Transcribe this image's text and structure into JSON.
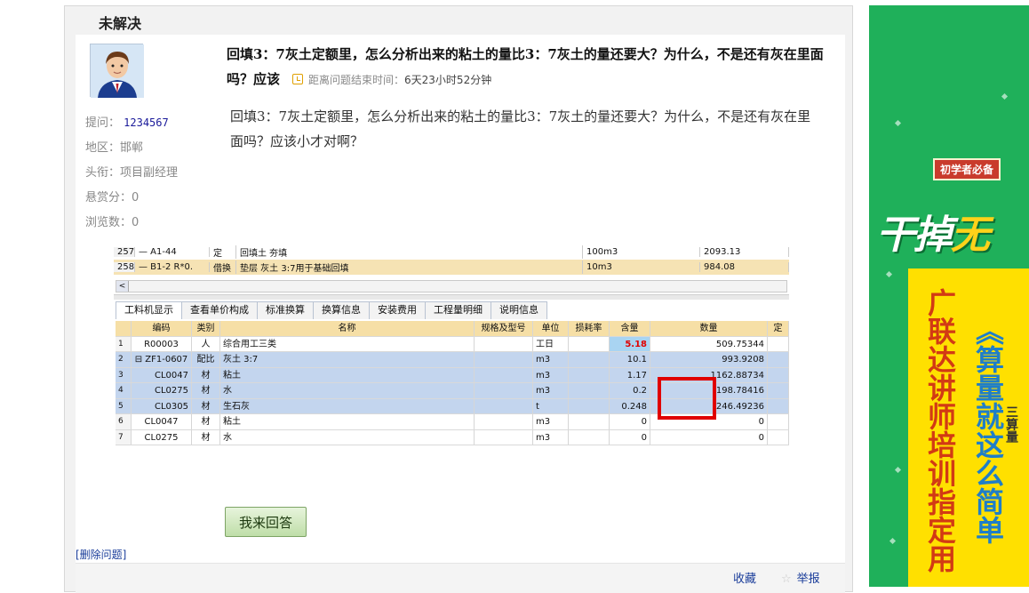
{
  "question": {
    "status": "未解决",
    "asker_label": "提问：",
    "asker": "1234567",
    "region_label": "地区：",
    "region": "邯郸",
    "rank_label": "头衔：",
    "rank": "项目副经理",
    "reward_label": "悬赏分：",
    "reward": "0",
    "views_label": "浏览数：",
    "views": "0",
    "title": "回填3：7灰土定额里，怎么分析出来的粘土的量比3：7灰土的量还要大？为什么，不是还有灰在里面吗？应该",
    "deadline_label": "距离问题结束时间：",
    "deadline_value": "6天23小时52分钟",
    "body": "回填3：7灰土定额里，怎么分析出来的粘土的量比3：7灰土的量还要大？为什么，不是还有灰在里面吗？应该小才对啊？",
    "answer_button": "我来回答",
    "delete_link": "[删除问题]",
    "favorite_link": "收藏",
    "report_link": "举报"
  },
  "screenshot": {
    "top_rows": [
      {
        "no": "257",
        "code": "— A1-44",
        "type": "定",
        "name": "回填土 夯填",
        "unit": "100m3",
        "qty": "2093.13"
      },
      {
        "no": "258",
        "code": "— B1-2 R*0.",
        "type": "借换",
        "name": "垫层 灰土 3:7用于基础回填",
        "unit": "10m3",
        "qty": "984.08"
      }
    ],
    "scroll_left": "<",
    "tabs": [
      "工料机显示",
      "查看单价构成",
      "标准换算",
      "换算信息",
      "安装费用",
      "工程量明细",
      "说明信息"
    ],
    "columns": [
      "",
      "编码",
      "类别",
      "名称",
      "规格及型号",
      "单位",
      "损耗率",
      "含量",
      "数量",
      "定"
    ],
    "rows": [
      {
        "no": "1",
        "code": "R00003",
        "type": "人",
        "name": "综合用工三类",
        "spec": "",
        "unit": "工日",
        "loss": "",
        "content": "5.18",
        "qty": "509.75344",
        "sel": false,
        "red": true
      },
      {
        "no": "2",
        "code": "⊟ ZF1-0607",
        "type": "配比",
        "name": "灰土 3:7",
        "spec": "",
        "unit": "m3",
        "loss": "",
        "content": "10.1",
        "qty": "993.9208",
        "sel": true,
        "red": false
      },
      {
        "no": "3",
        "code": "CL0047",
        "type": "材",
        "name": "粘土",
        "spec": "",
        "unit": "m3",
        "loss": "",
        "content": "1.17",
        "qty": "1162.88734",
        "sel": true,
        "red": false
      },
      {
        "no": "4",
        "code": "CL0275",
        "type": "材",
        "name": "水",
        "spec": "",
        "unit": "m3",
        "loss": "",
        "content": "0.2",
        "qty": "198.78416",
        "sel": true,
        "red": false
      },
      {
        "no": "5",
        "code": "CL0305",
        "type": "材",
        "name": "生石灰",
        "spec": "",
        "unit": "t",
        "loss": "",
        "content": "0.248",
        "qty": "246.49236",
        "sel": true,
        "red": false
      },
      {
        "no": "6",
        "code": "CL0047",
        "type": "材",
        "name": "粘土",
        "spec": "",
        "unit": "m3",
        "loss": "",
        "content": "0",
        "qty": "0",
        "sel": false,
        "red": false
      },
      {
        "no": "7",
        "code": "CL0275",
        "type": "材",
        "name": "水",
        "spec": "",
        "unit": "m3",
        "loss": "",
        "content": "0",
        "qty": "0",
        "sel": false,
        "red": false
      }
    ]
  },
  "ad": {
    "badge": "初学者必备",
    "slogan_white": "干掉",
    "slogan_yellow": "无",
    "vertical_1": "广联达讲师培训指定用",
    "vertical_2": "《算量就这么简单",
    "vertical_3": "三算量"
  },
  "colors": {
    "ad_green": "#1fb05a",
    "ad_yellow": "#ffe000",
    "highlight_red": "#e00000",
    "selected_row": "#c3d5ee"
  }
}
